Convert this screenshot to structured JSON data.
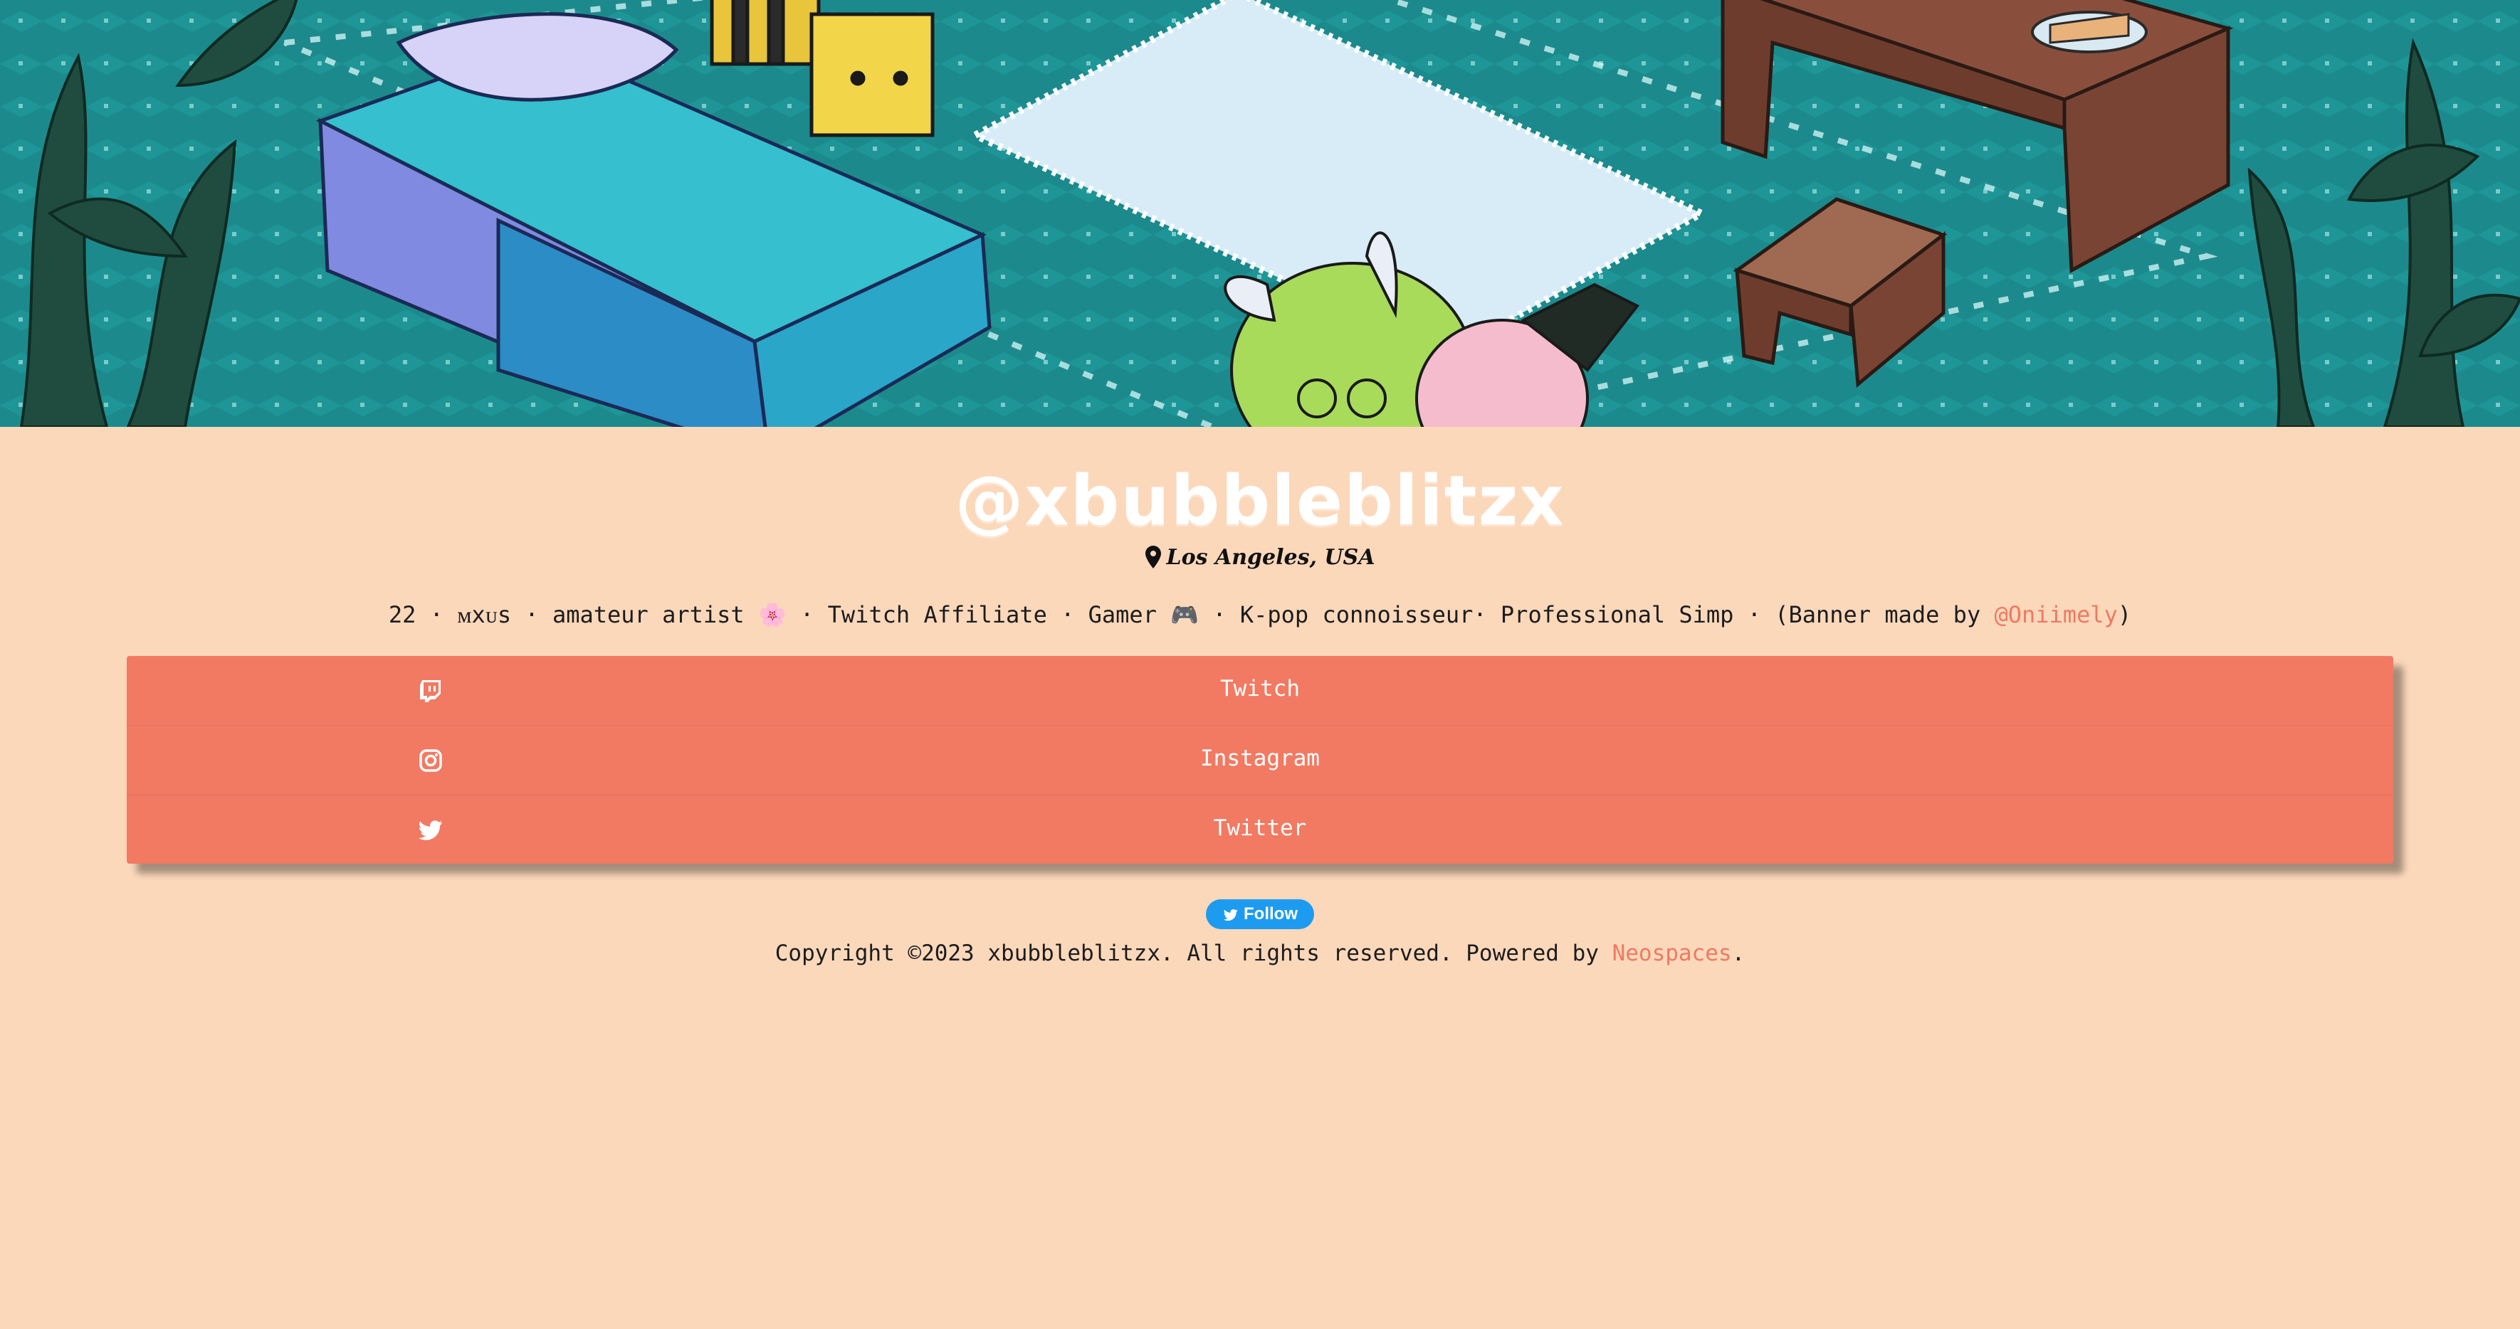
{
  "profile": {
    "username": "@xbubbleblitzx",
    "location": "Los Angeles, USA",
    "bio": {
      "part1": "22 · ᴍxᴜs · amateur artist 🌸 · Twitch Affiliate · Gamer 🎮 · K-pop connoisseur· Professional Simp · (Banner made by ",
      "credit_link": "@Oniimely",
      "part2": ")"
    }
  },
  "links": [
    {
      "label": "Twitch",
      "icon": "twitch-icon"
    },
    {
      "label": "Instagram",
      "icon": "instagram-icon"
    },
    {
      "label": "Twitter",
      "icon": "twitter-icon"
    }
  ],
  "follow_button": {
    "label": "Follow",
    "icon": "twitter-bird-icon"
  },
  "footer": {
    "text": "Copyright ©2023 xbubbleblitzx. All rights reserved. Powered by ",
    "link": "Neospaces",
    "end": "."
  },
  "colors": {
    "background": "#fcd8bb",
    "accent": "#f27a62",
    "link": "#ef7a62",
    "follow": "#1d9bf0"
  }
}
